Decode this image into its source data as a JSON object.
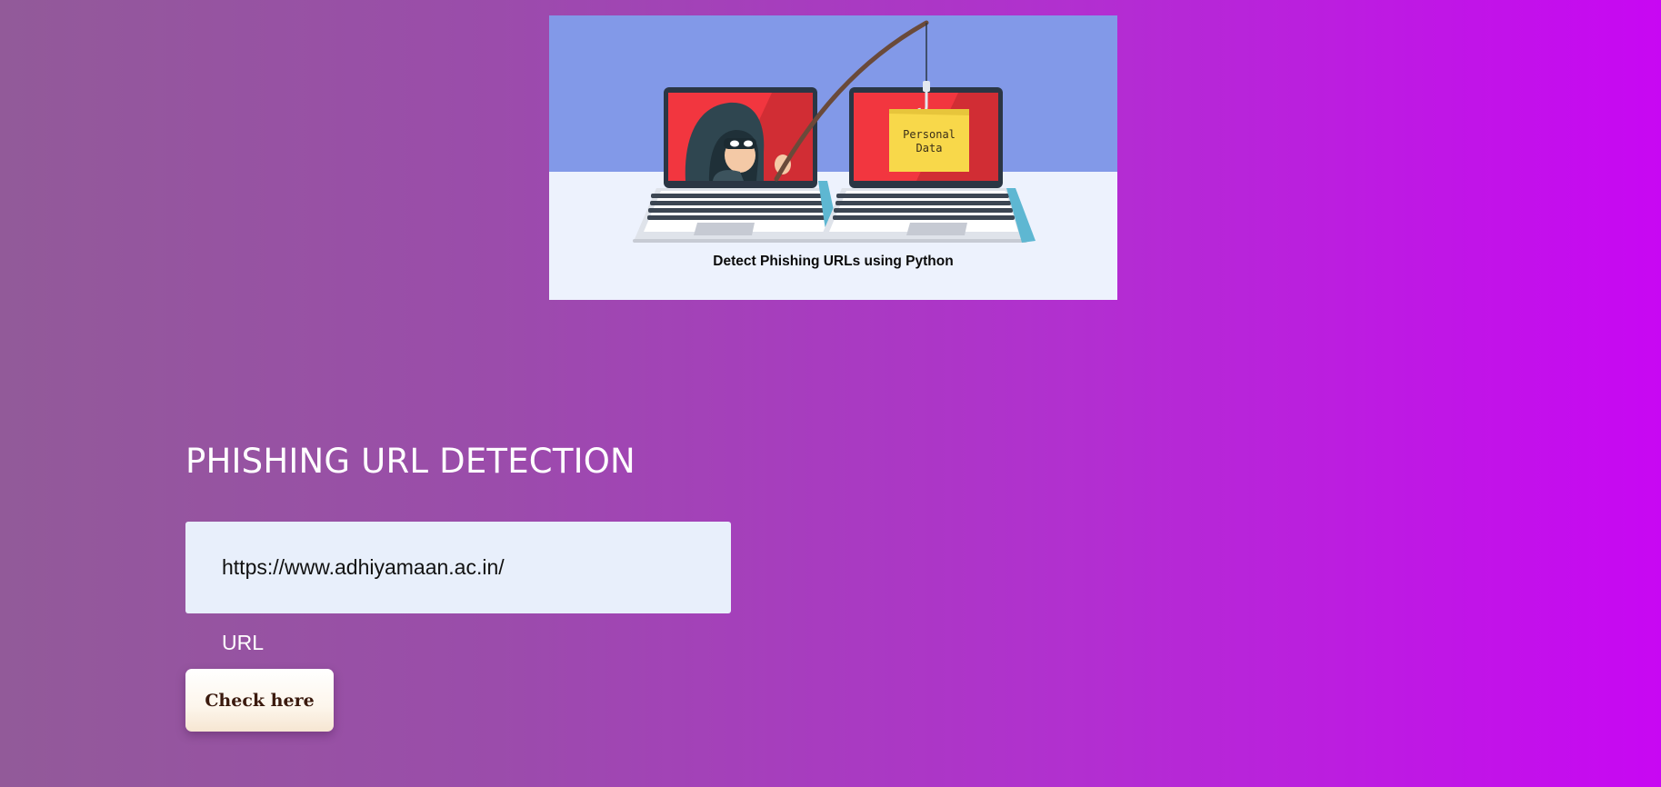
{
  "banner": {
    "caption": "Detect Phishing URLs using Python",
    "note_text_line1": "Personal",
    "note_text_line2": "Data",
    "image_icon": "phishing-illustration-icon",
    "colors": {
      "sky": "#8299e8",
      "floor": "#edf2fd",
      "screen_red": "#f2363f",
      "note_yellow": "#f8d84a"
    }
  },
  "main": {
    "title": "PHISHING URL DETECTION",
    "url_input": {
      "value": "https://www.adhiyamaan.ac.in/",
      "placeholder": ""
    },
    "url_label": "URL",
    "check_button_label": "Check here"
  },
  "theme": {
    "background_gradient_start": "#925a99",
    "background_gradient_end": "#c807f3",
    "input_background": "#e8effb"
  }
}
